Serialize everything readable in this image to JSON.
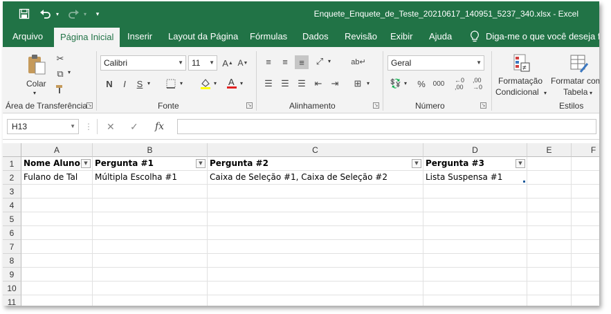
{
  "titlebar": {
    "title": "Enquete_Enquete_de_Teste_20210617_140951_5237_340.xlsx  -  Excel",
    "qat": {
      "save_icon": "save-icon",
      "undo_icon": "undo-icon",
      "redo_icon": "redo-icon",
      "customize_icon": "customize-icon"
    }
  },
  "tabs": [
    "Arquivo",
    "Página Inicial",
    "Inserir",
    "Layout da Página",
    "Fórmulas",
    "Dados",
    "Revisão",
    "Exibir",
    "Ajuda"
  ],
  "active_tab": "Página Inicial",
  "tell_me": "Diga-me o que você deseja fazer",
  "ribbon": {
    "clipboard": {
      "label": "Área de Transferência",
      "paste": "Colar"
    },
    "font": {
      "label": "Fonte",
      "name": "Calibri",
      "size": "11"
    },
    "alignment": {
      "label": "Alinhamento"
    },
    "number": {
      "label": "Número",
      "format": "Geral"
    },
    "styles": {
      "label": "Estilos",
      "conditional_line1": "Formatação",
      "conditional_line2": "Condicional",
      "table_line1": "Formatar como",
      "table_line2": "Tabela"
    }
  },
  "formula_bar": {
    "name_box": "H13",
    "formula": ""
  },
  "sheet": {
    "columns": [
      "A",
      "B",
      "C",
      "D",
      "E",
      "F"
    ],
    "rows": [
      "1",
      "2",
      "3",
      "4",
      "5",
      "6",
      "7",
      "8",
      "9",
      "10",
      "11"
    ],
    "headers": [
      "Nome Aluno",
      "Pergunta #1",
      "Pergunta #2",
      "Pergunta #3"
    ],
    "data": [
      [
        "Fulano de Tal",
        "Múltipla Escolha #1",
        "Caixa de Seleção  #1, Caixa de Seleção  #2",
        "Lista Suspensa #1"
      ]
    ]
  },
  "colors": {
    "accent": "#217346",
    "ribbon_bg": "#f3f3f3",
    "grid_line": "#e1e1e1"
  }
}
